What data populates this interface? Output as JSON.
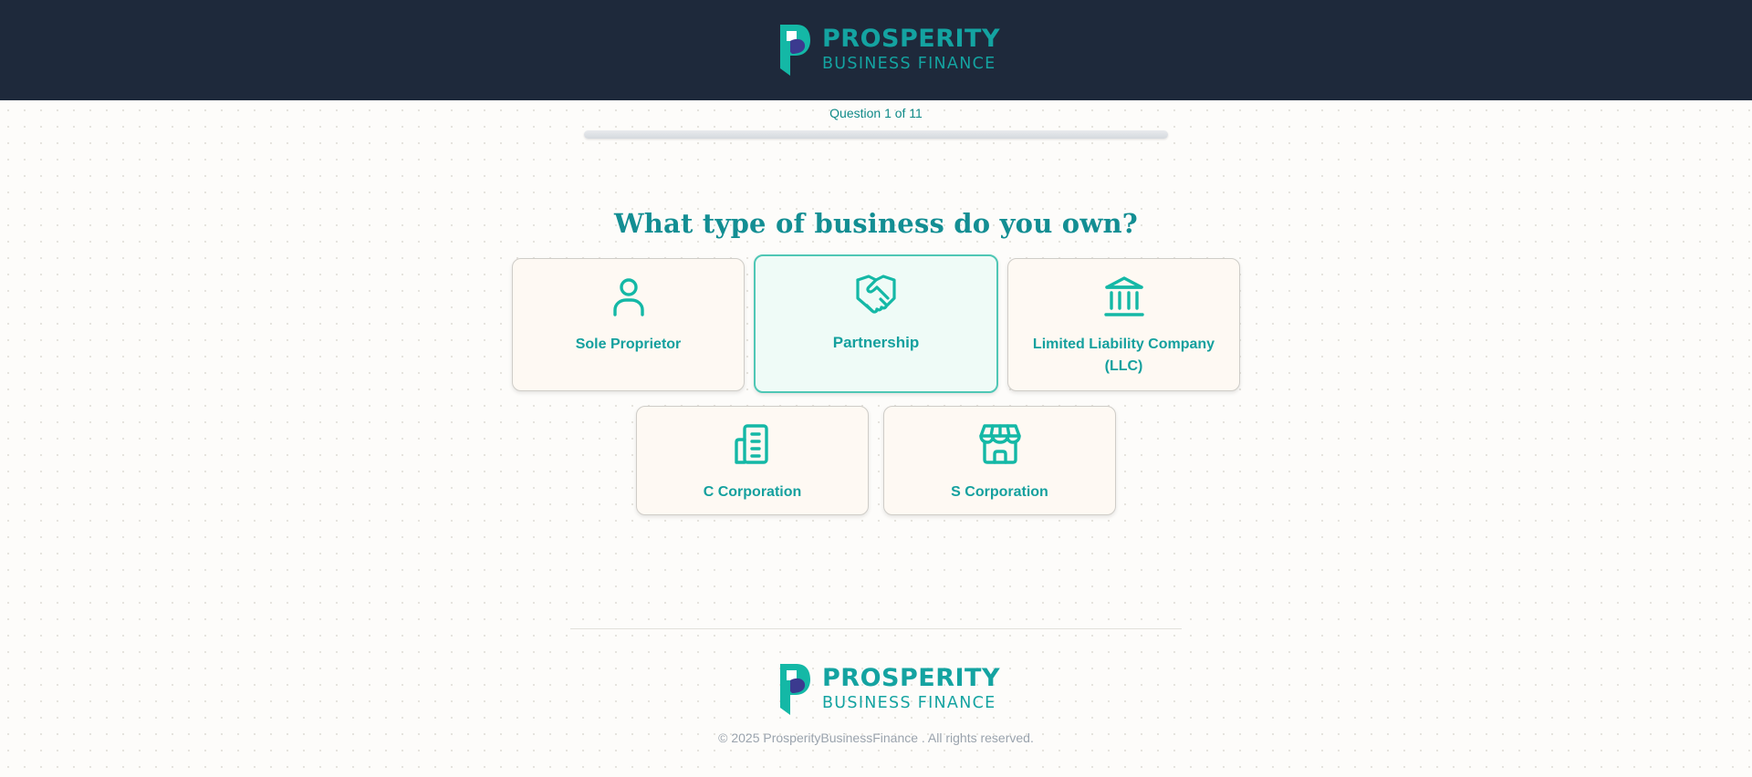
{
  "brand": {
    "name_line1": "PROSPERITY",
    "name_line2": "BUSINESS FINANCE",
    "colors": {
      "header_bg": "#1e293b",
      "accent": "#14a3a1",
      "mark_teal": "#14b8a6",
      "mark_purple": "#3b3a8f"
    }
  },
  "progress": {
    "label": "Question 1 of 11",
    "current": 1,
    "total": 11,
    "fill_fraction": 0
  },
  "question": {
    "title": "What type of business do you own?"
  },
  "options": [
    {
      "label": "Sole Proprietor",
      "icon": "person-icon",
      "selected": false
    },
    {
      "label": "Partnership",
      "icon": "handshake-icon",
      "selected": true
    },
    {
      "label": "Limited Liability Company (LLC)",
      "icon": "bank-icon",
      "selected": false
    },
    {
      "label": "C Corporation",
      "icon": "office-building-icon",
      "selected": false
    },
    {
      "label": "S Corporation",
      "icon": "store-icon",
      "selected": false
    }
  ],
  "footer": {
    "copyright": "© 2025 ProsperityBusinessFinance . All rights reserved."
  }
}
